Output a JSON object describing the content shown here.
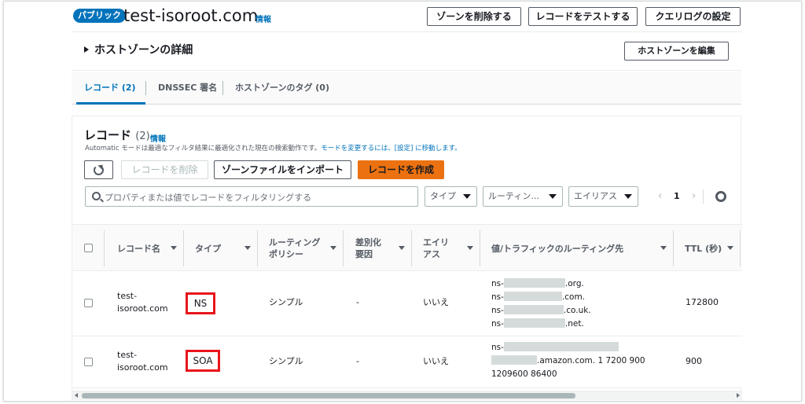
{
  "header": {
    "badge": "パブリック",
    "zone_name": "test-isoroot.com",
    "info": "情報",
    "buttons": {
      "delete_zone": "ゾーンを削除する",
      "test_record": "レコードをテストする",
      "query_log": "クエリログの設定"
    }
  },
  "details": {
    "title": "ホストゾーンの詳細",
    "edit_button": "ホストゾーンを編集"
  },
  "tabs": [
    {
      "label": "レコード (2)",
      "active": true
    },
    {
      "label": "DNSSEC 署名",
      "active": false
    },
    {
      "label": "ホストゾーンのタグ (0)",
      "active": false
    }
  ],
  "records": {
    "title": "レコード",
    "count": "(2)",
    "info": "情報",
    "description": "Automatic モードは最適なフィルタ結果に最適化された現在の検索動作です。",
    "description_link": "モードを変更するには、[設定] に移動します。",
    "toolbar": {
      "delete": "レコードを削除",
      "import": "ゾーンファイルをインポート",
      "create": "レコードを作成"
    },
    "search_placeholder": "プロパティまたは値でレコードをフィルタリングする",
    "filters": {
      "type": "タイプ",
      "routing": "ルーティン...",
      "alias": "エイリアス"
    },
    "pager": {
      "prev": "‹",
      "page": "1",
      "next": "›"
    },
    "columns": {
      "name": "レコード名",
      "type": "タイプ",
      "routing_1": "ルーティング",
      "routing_2": "ポリシー",
      "diff_1": "差別化",
      "diff_2": "要因",
      "alias_1": "エイリ",
      "alias_2": "アス",
      "value": "値/トラフィックのルーティング先",
      "ttl": "TTL (秒)"
    },
    "rows": [
      {
        "name_1": "test-",
        "name_2": "isoroot.com",
        "type": "NS",
        "routing": "シンプル",
        "diff": "-",
        "alias": "いいえ",
        "values": [
          {
            "prefix": "ns-",
            "suffix": ".org."
          },
          {
            "prefix": "ns-",
            "suffix": ".com."
          },
          {
            "prefix": "ns-",
            "suffix": ".co.uk."
          },
          {
            "prefix": "ns-",
            "suffix": ".net."
          }
        ],
        "ttl": "172800"
      },
      {
        "name_1": "test-",
        "name_2": "isoroot.com",
        "type": "SOA",
        "routing": "シンプル",
        "diff": "-",
        "alias": "いいえ",
        "value_line1": "ns-",
        "value_line2": ".amazon.com. 1 7200 900",
        "value_line3": "1209600 86400",
        "ttl": "900"
      }
    ]
  },
  "colors": {
    "primary_link": "#0073bb",
    "create_button": "#ec7211",
    "highlight": "#e8151b"
  }
}
